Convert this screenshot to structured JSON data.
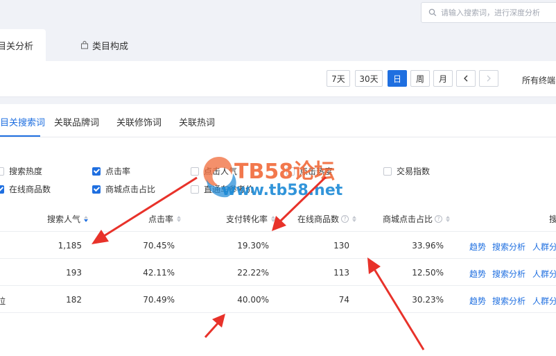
{
  "search": {
    "placeholder": "请输入搜索词，进行深度分析"
  },
  "main_tabs": [
    {
      "label": "相关分析",
      "visible_label": "目关分析",
      "active": true
    },
    {
      "label": "类目构成",
      "active": false
    }
  ],
  "date_buttons": [
    {
      "label": "7天",
      "active": false
    },
    {
      "label": "30天",
      "active": false
    },
    {
      "label": "日",
      "active": true
    },
    {
      "label": "周",
      "active": false
    },
    {
      "label": "月",
      "active": false
    },
    {
      "label": "‹",
      "active": false
    },
    {
      "label": "›",
      "active": false,
      "disabled": true
    }
  ],
  "terminal_label": "所有终端",
  "sub_tabs": [
    {
      "label": "目关搜索词",
      "active": true
    },
    {
      "label": "关联品牌词",
      "active": false
    },
    {
      "label": "关联修饰词",
      "active": false
    },
    {
      "label": "关联热词",
      "active": false
    }
  ],
  "metrics": {
    "row1": [
      {
        "label": "搜索热度",
        "checked": false
      },
      {
        "label": "点击率",
        "checked": true
      },
      {
        "label": "点击人气",
        "checked": false
      },
      {
        "label": "点击热度",
        "checked": false
      },
      {
        "label": "交易指数",
        "checked": false
      }
    ],
    "row2": [
      {
        "label": "在线商品数",
        "checked": true
      },
      {
        "label": "商城点击占比",
        "checked": true
      },
      {
        "label": "直通车参考价",
        "checked": false
      }
    ]
  },
  "table": {
    "headers": [
      "搜索人气",
      "点击率",
      "支付转化率",
      "在线商品数",
      "商城点击占比",
      "搜"
    ],
    "rows": [
      {
        "prefix": "",
        "popularity": "1,185",
        "ctr": "70.45%",
        "conversion": "19.30%",
        "items": "130",
        "mall_ratio": "33.96%"
      },
      {
        "prefix": "",
        "popularity": "193",
        "ctr": "42.11%",
        "conversion": "22.22%",
        "items": "113",
        "mall_ratio": "12.50%"
      },
      {
        "prefix": "拉",
        "popularity": "182",
        "ctr": "70.49%",
        "conversion": "40.00%",
        "items": "74",
        "mall_ratio": "30.23%"
      }
    ],
    "actions": [
      "趋势",
      "搜索分析",
      "人群分"
    ]
  },
  "watermark": {
    "title": "TB58论坛",
    "url": "www.tb58.net"
  },
  "colors": {
    "accent": "#1f6fe0",
    "arrow": "#e8322a",
    "band": "#f0f2f7"
  }
}
